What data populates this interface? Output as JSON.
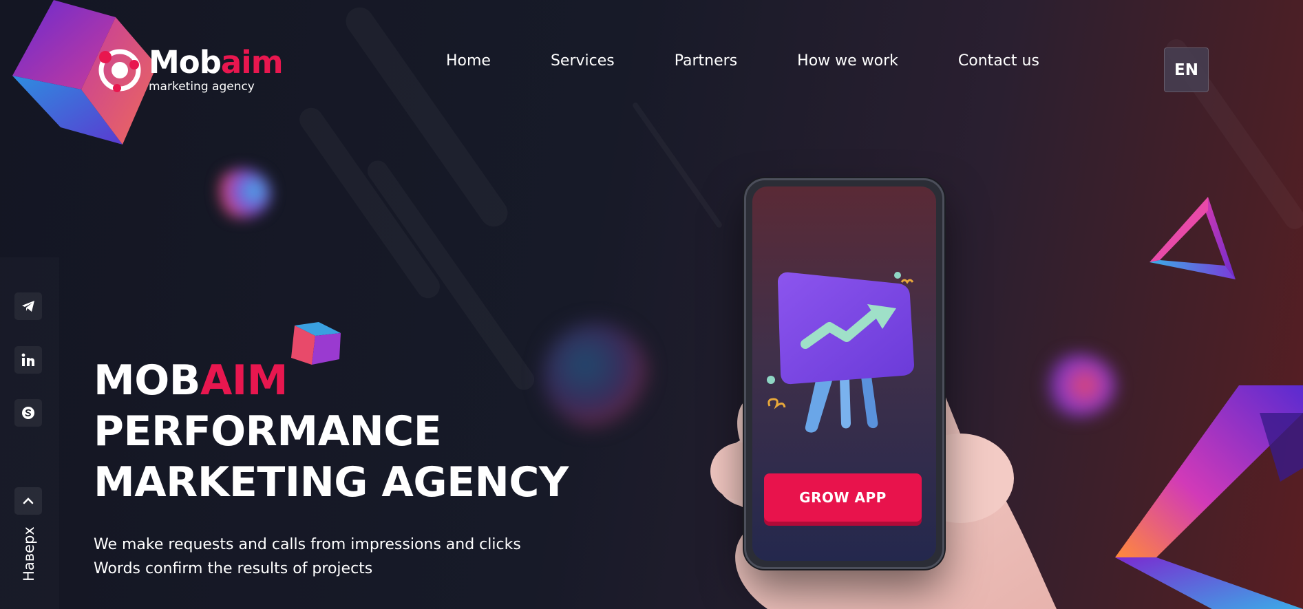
{
  "logo": {
    "name_part1": "Mob",
    "name_part2": "aim",
    "tagline": "marketing agency"
  },
  "nav": {
    "items": [
      {
        "label": "Home"
      },
      {
        "label": "Services"
      },
      {
        "label": "Partners"
      },
      {
        "label": "How we work"
      },
      {
        "label": "Contact us"
      }
    ]
  },
  "language": {
    "label": "EN"
  },
  "social": {
    "icons": [
      "telegram-icon",
      "linkedin-icon",
      "skype-icon"
    ]
  },
  "back_to_top": {
    "label": "Наверх",
    "icon": "chevron-up-icon"
  },
  "hero": {
    "title_part1": "MOB",
    "title_part2": "AIM",
    "title_line2": "PERFORMANCE",
    "title_line3": "MARKETING AGENCY",
    "desc_line1": "We make requests and calls from impressions and clicks",
    "desc_line2": "Words confirm the results of projects"
  },
  "phone": {
    "cta_label": "GROW APP"
  },
  "colors": {
    "accent": "#e8174f",
    "background": "#141623",
    "button": "#e8134c"
  }
}
